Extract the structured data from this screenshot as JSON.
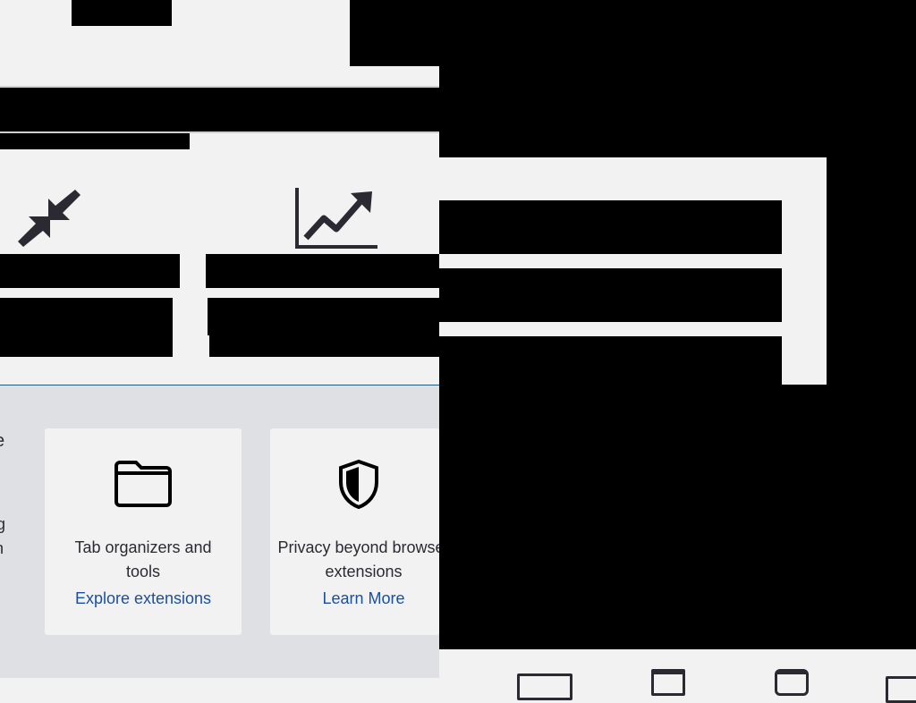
{
  "features": {
    "cards": [
      {
        "icon": "folder-icon",
        "title": "Tab organizers and tools",
        "link": "Explore extensions"
      },
      {
        "icon": "shield-icon",
        "title": "Privacy beyond browser extensions",
        "link": "Learn More"
      }
    ],
    "icons_top": [
      "compress-arrows-icon",
      "trending-chart-icon"
    ],
    "bottom_icons": [
      "window-folder-icon",
      "window-icon",
      "device-icon",
      "window-partial-icon"
    ]
  },
  "colors": {
    "page_bg": "#f2f2f2",
    "gray_panel": "#dfe0e3",
    "link": "#1b4f9e",
    "text": "#2b2a33",
    "accent_line": "#1f5a7a"
  },
  "fragments": {
    "left_edge_chars": [
      "e",
      "g",
      "n"
    ]
  }
}
